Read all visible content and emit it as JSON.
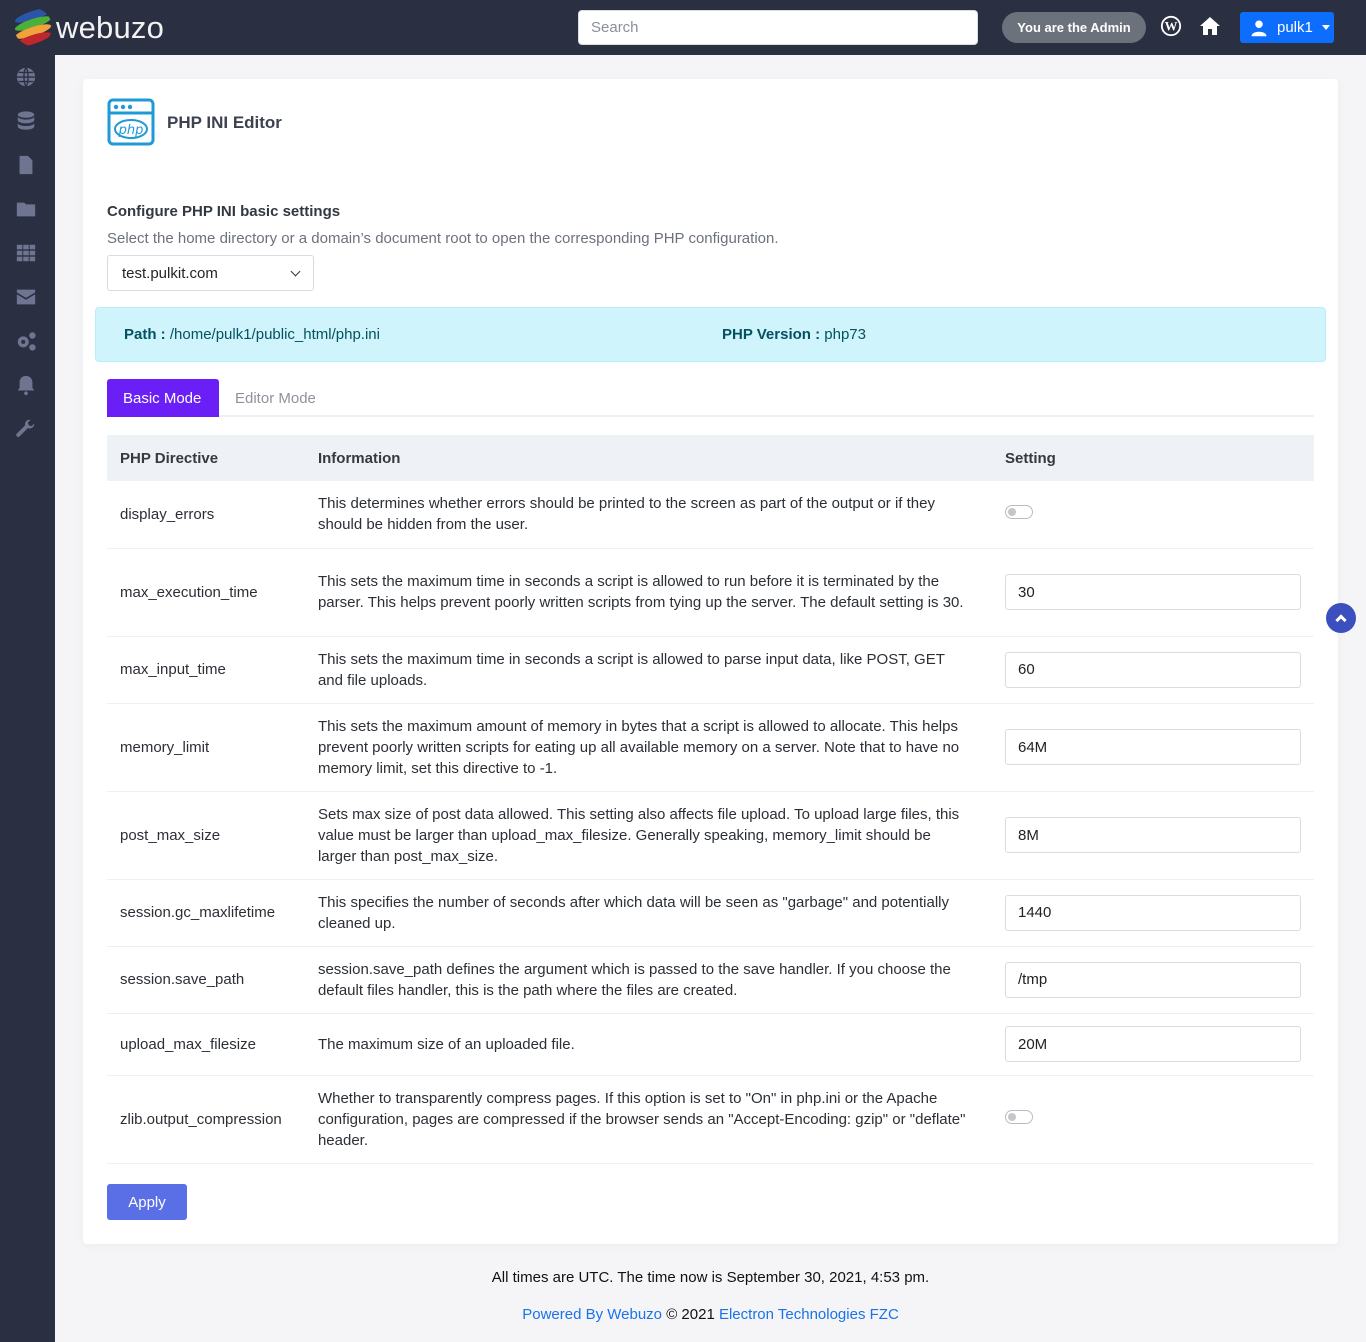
{
  "header": {
    "logo_text": "webuzo",
    "search_placeholder": "Search",
    "admin_badge": "You are the Admin",
    "user_name": "pulk1",
    "icons": [
      "wordpress-icon",
      "home-icon",
      "user-icon"
    ]
  },
  "sidebar": {
    "items": [
      {
        "icon": "globe-icon"
      },
      {
        "icon": "database-icon"
      },
      {
        "icon": "file-icon"
      },
      {
        "icon": "folder-icon"
      },
      {
        "icon": "apps-grid-icon"
      },
      {
        "icon": "mail-icon"
      },
      {
        "icon": "gears-icon"
      },
      {
        "icon": "bell-icon"
      },
      {
        "icon": "wrench-icon"
      }
    ]
  },
  "page": {
    "title": "PHP INI Editor",
    "section_title": "Configure PHP INI basic settings",
    "section_subtitle": "Select the home directory or a domain’s document root to open the corresponding PHP configuration.",
    "selected_domain": "test.pulkit.com",
    "path_label": "Path :",
    "path_value": "/home/pulk1/public_html/php.ini",
    "version_label": "PHP Version :",
    "version_value": "php73",
    "tabs": [
      {
        "label": "Basic Mode",
        "active": true
      },
      {
        "label": "Editor Mode",
        "active": false
      }
    ],
    "table": {
      "headers": [
        "PHP Directive",
        "Information",
        "Setting"
      ],
      "rows": [
        {
          "directive": "display_errors",
          "info": "This determines whether errors should be printed to the screen as part of the output or if they should be hidden from the user.",
          "type": "toggle",
          "value": "off"
        },
        {
          "directive": "max_execution_time",
          "info": "This sets the maximum time in seconds a script is allowed to run before it is terminated by the parser. This helps prevent poorly written scripts from tying up the server. The default setting is 30.",
          "type": "input",
          "value": "30"
        },
        {
          "directive": "max_input_time",
          "info": "This sets the maximum time in seconds a script is allowed to parse input data, like POST, GET and file uploads.",
          "type": "input",
          "value": "60"
        },
        {
          "directive": "memory_limit",
          "info": "This sets the maximum amount of memory in bytes that a script is allowed to allocate. This helps prevent poorly written scripts for eating up all available memory on a server. Note that to have no memory limit, set this directive to -1.",
          "type": "input",
          "value": "64M"
        },
        {
          "directive": "post_max_size",
          "info": "Sets max size of post data allowed. This setting also affects file upload. To upload large files, this value must be larger than upload_max_filesize. Generally speaking, memory_limit should be larger than post_max_size.",
          "type": "input",
          "value": "8M"
        },
        {
          "directive": "session.gc_maxlifetime",
          "info": "This specifies the number of seconds after which data will be seen as \"garbage\" and potentially cleaned up.",
          "type": "input",
          "value": "1440"
        },
        {
          "directive": "session.save_path",
          "info": "session.save_path defines the argument which is passed to the save handler. If you choose the default files handler, this is the path where the files are created.",
          "type": "input",
          "value": "/tmp"
        },
        {
          "directive": "upload_max_filesize",
          "info": "The maximum size of an uploaded file.",
          "type": "input",
          "value": "20M"
        },
        {
          "directive": "zlib.output_compression",
          "info": "Whether to transparently compress pages. If this option is set to \"On\" in php.ini or the Apache configuration, pages are compressed if the browser sends an \"Accept-Encoding: gzip\" or \"deflate\" header.",
          "type": "toggle",
          "value": "off"
        }
      ]
    },
    "apply_label": "Apply"
  },
  "footer": {
    "time_text": "All times are UTC. The time now is September 30, 2021, 4:53 pm.",
    "powered_by": "Powered By Webuzo",
    "copyright": " © 2021 ",
    "company": "Electron Technologies FZC"
  },
  "colors": {
    "topbar": "#2a2f42",
    "primary_tab": "#6a1ff6",
    "apply_button": "#5a6fe5",
    "user_button": "#0d6efd",
    "info_bar": "#cff4fc"
  }
}
